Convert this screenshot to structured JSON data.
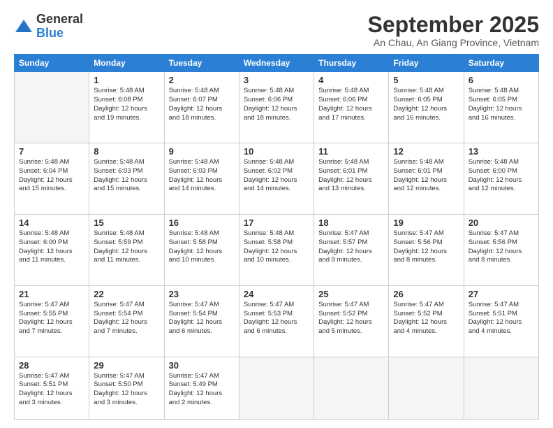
{
  "logo": {
    "general": "General",
    "blue": "Blue"
  },
  "title": "September 2025",
  "subtitle": "An Chau, An Giang Province, Vietnam",
  "days_of_week": [
    "Sunday",
    "Monday",
    "Tuesday",
    "Wednesday",
    "Thursday",
    "Friday",
    "Saturday"
  ],
  "weeks": [
    [
      {
        "day": "",
        "info": ""
      },
      {
        "day": "1",
        "info": "Sunrise: 5:48 AM\nSunset: 6:08 PM\nDaylight: 12 hours\nand 19 minutes."
      },
      {
        "day": "2",
        "info": "Sunrise: 5:48 AM\nSunset: 6:07 PM\nDaylight: 12 hours\nand 18 minutes."
      },
      {
        "day": "3",
        "info": "Sunrise: 5:48 AM\nSunset: 6:06 PM\nDaylight: 12 hours\nand 18 minutes."
      },
      {
        "day": "4",
        "info": "Sunrise: 5:48 AM\nSunset: 6:06 PM\nDaylight: 12 hours\nand 17 minutes."
      },
      {
        "day": "5",
        "info": "Sunrise: 5:48 AM\nSunset: 6:05 PM\nDaylight: 12 hours\nand 16 minutes."
      },
      {
        "day": "6",
        "info": "Sunrise: 5:48 AM\nSunset: 6:05 PM\nDaylight: 12 hours\nand 16 minutes."
      }
    ],
    [
      {
        "day": "7",
        "info": "Sunrise: 5:48 AM\nSunset: 6:04 PM\nDaylight: 12 hours\nand 15 minutes."
      },
      {
        "day": "8",
        "info": "Sunrise: 5:48 AM\nSunset: 6:03 PM\nDaylight: 12 hours\nand 15 minutes."
      },
      {
        "day": "9",
        "info": "Sunrise: 5:48 AM\nSunset: 6:03 PM\nDaylight: 12 hours\nand 14 minutes."
      },
      {
        "day": "10",
        "info": "Sunrise: 5:48 AM\nSunset: 6:02 PM\nDaylight: 12 hours\nand 14 minutes."
      },
      {
        "day": "11",
        "info": "Sunrise: 5:48 AM\nSunset: 6:01 PM\nDaylight: 12 hours\nand 13 minutes."
      },
      {
        "day": "12",
        "info": "Sunrise: 5:48 AM\nSunset: 6:01 PM\nDaylight: 12 hours\nand 12 minutes."
      },
      {
        "day": "13",
        "info": "Sunrise: 5:48 AM\nSunset: 6:00 PM\nDaylight: 12 hours\nand 12 minutes."
      }
    ],
    [
      {
        "day": "14",
        "info": "Sunrise: 5:48 AM\nSunset: 6:00 PM\nDaylight: 12 hours\nand 11 minutes."
      },
      {
        "day": "15",
        "info": "Sunrise: 5:48 AM\nSunset: 5:59 PM\nDaylight: 12 hours\nand 11 minutes."
      },
      {
        "day": "16",
        "info": "Sunrise: 5:48 AM\nSunset: 5:58 PM\nDaylight: 12 hours\nand 10 minutes."
      },
      {
        "day": "17",
        "info": "Sunrise: 5:48 AM\nSunset: 5:58 PM\nDaylight: 12 hours\nand 10 minutes."
      },
      {
        "day": "18",
        "info": "Sunrise: 5:47 AM\nSunset: 5:57 PM\nDaylight: 12 hours\nand 9 minutes."
      },
      {
        "day": "19",
        "info": "Sunrise: 5:47 AM\nSunset: 5:56 PM\nDaylight: 12 hours\nand 8 minutes."
      },
      {
        "day": "20",
        "info": "Sunrise: 5:47 AM\nSunset: 5:56 PM\nDaylight: 12 hours\nand 8 minutes."
      }
    ],
    [
      {
        "day": "21",
        "info": "Sunrise: 5:47 AM\nSunset: 5:55 PM\nDaylight: 12 hours\nand 7 minutes."
      },
      {
        "day": "22",
        "info": "Sunrise: 5:47 AM\nSunset: 5:54 PM\nDaylight: 12 hours\nand 7 minutes."
      },
      {
        "day": "23",
        "info": "Sunrise: 5:47 AM\nSunset: 5:54 PM\nDaylight: 12 hours\nand 6 minutes."
      },
      {
        "day": "24",
        "info": "Sunrise: 5:47 AM\nSunset: 5:53 PM\nDaylight: 12 hours\nand 6 minutes."
      },
      {
        "day": "25",
        "info": "Sunrise: 5:47 AM\nSunset: 5:52 PM\nDaylight: 12 hours\nand 5 minutes."
      },
      {
        "day": "26",
        "info": "Sunrise: 5:47 AM\nSunset: 5:52 PM\nDaylight: 12 hours\nand 4 minutes."
      },
      {
        "day": "27",
        "info": "Sunrise: 5:47 AM\nSunset: 5:51 PM\nDaylight: 12 hours\nand 4 minutes."
      }
    ],
    [
      {
        "day": "28",
        "info": "Sunrise: 5:47 AM\nSunset: 5:51 PM\nDaylight: 12 hours\nand 3 minutes."
      },
      {
        "day": "29",
        "info": "Sunrise: 5:47 AM\nSunset: 5:50 PM\nDaylight: 12 hours\nand 3 minutes."
      },
      {
        "day": "30",
        "info": "Sunrise: 5:47 AM\nSunset: 5:49 PM\nDaylight: 12 hours\nand 2 minutes."
      },
      {
        "day": "",
        "info": ""
      },
      {
        "day": "",
        "info": ""
      },
      {
        "day": "",
        "info": ""
      },
      {
        "day": "",
        "info": ""
      }
    ]
  ]
}
